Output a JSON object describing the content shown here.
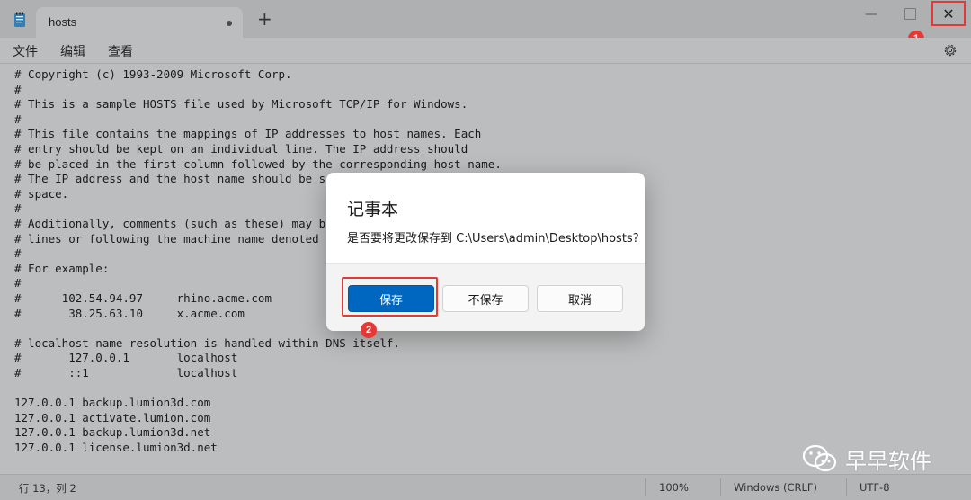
{
  "window": {
    "tab_title": "hosts",
    "new_tab_label": "+",
    "minimize_label": "—",
    "close_label": "✕"
  },
  "menu": {
    "items": [
      "文件",
      "编辑",
      "查看"
    ]
  },
  "editor": {
    "lines": [
      "# Copyright (c) 1993-2009 Microsoft Corp.",
      "#",
      "# This is a sample HOSTS file used by Microsoft TCP/IP for Windows.",
      "#",
      "# This file contains the mappings of IP addresses to host names. Each",
      "# entry should be kept on an individual line. The IP address should",
      "# be placed in the first column followed by the corresponding host name.",
      "# The IP address and the host name should be s",
      "# space.",
      "#",
      "# Additionally, comments (such as these) may b",
      "# lines or following the machine name denoted",
      "#",
      "# For example:",
      "#",
      "#      102.54.94.97     rhino.acme.com",
      "#       38.25.63.10     x.acme.com",
      "",
      "# localhost name resolution is handled within DNS itself.",
      "#       127.0.0.1       localhost",
      "#       ::1             localhost",
      "",
      "127.0.0.1 backup.lumion3d.com",
      "127.0.0.1 activate.lumion.com",
      "127.0.0.1 backup.lumion3d.net",
      "127.0.0.1 license.lumion3d.net"
    ]
  },
  "status": {
    "position": "行 13，列 2",
    "zoom": "100%",
    "line_ending": "Windows (CRLF)",
    "encoding": "UTF-8"
  },
  "dialog": {
    "title": "记事本",
    "message": "是否要将更改保存到 C:\\Users\\admin\\Desktop\\hosts?",
    "save_label": "保存",
    "dont_save_label": "不保存",
    "cancel_label": "取消"
  },
  "annotations": {
    "marker_1": "1",
    "marker_2": "2"
  },
  "watermark": {
    "text": "早早软件"
  },
  "colors": {
    "accent": "#0067c0",
    "marker_red": "#e53935"
  }
}
